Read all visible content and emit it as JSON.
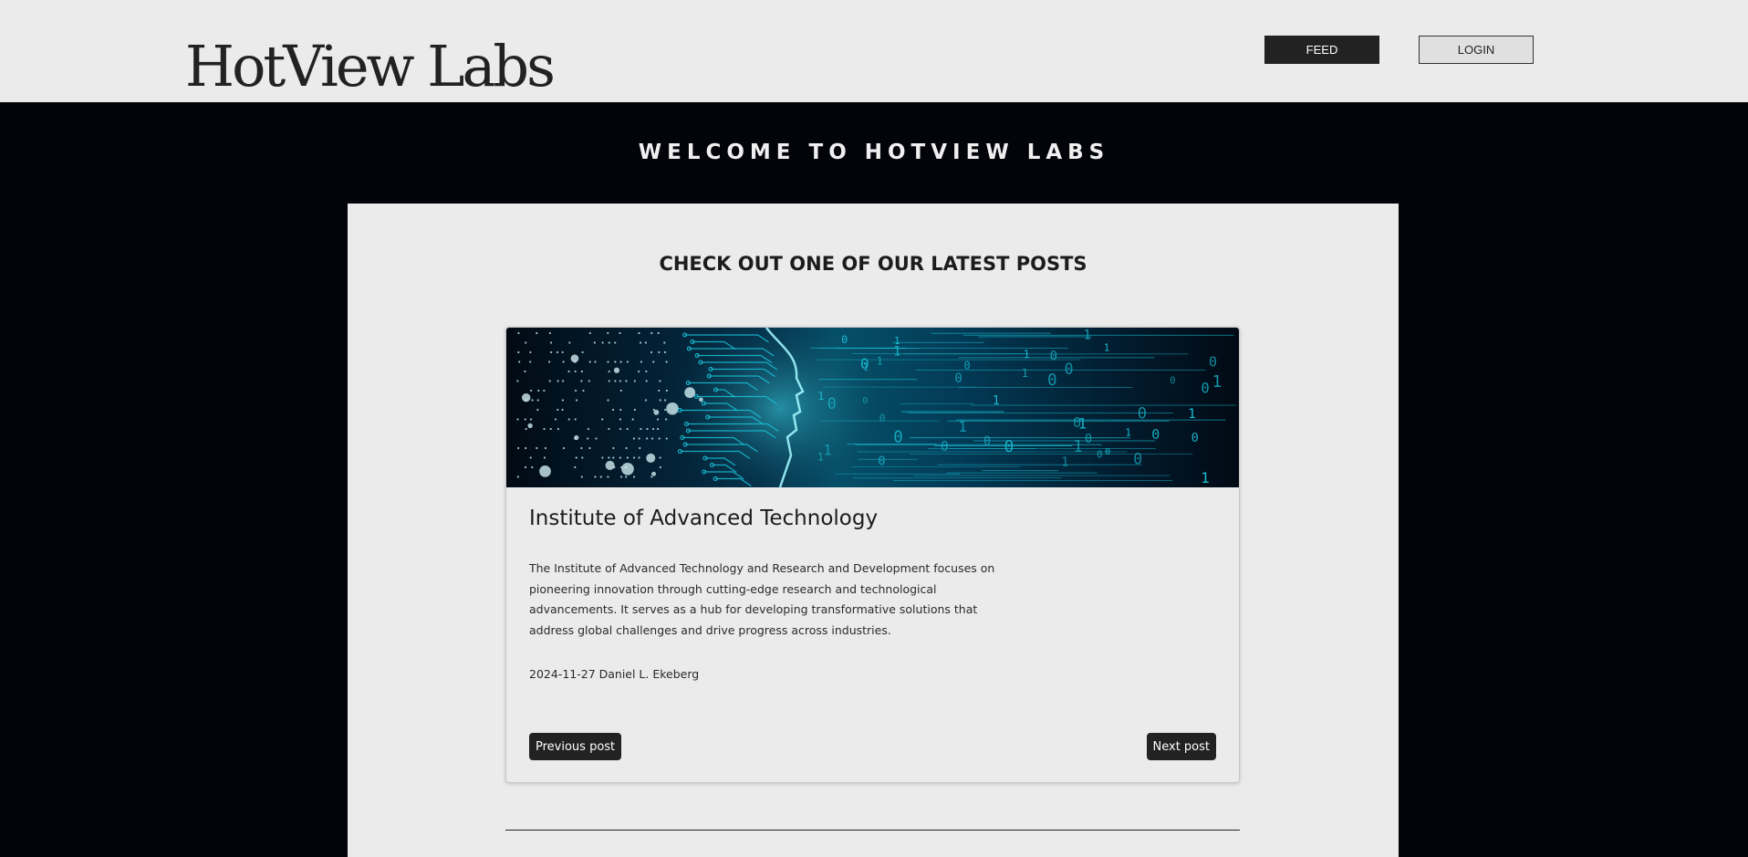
{
  "header": {
    "logo": "HotView Labs",
    "nav": {
      "feed_label": "FEED",
      "login_label": "LOGIN"
    }
  },
  "hero": {
    "title": "WELCOME TO HOTVIEW LABS"
  },
  "latest": {
    "title": "CHECK OUT ONE OF OUR LATEST POSTS",
    "post": {
      "title": "Institute of Advanced Technology",
      "body": "The Institute of Advanced Technology and Research and Development focuses on pioneering innovation through cutting-edge research and technological advancements. It serves as a hub for developing transformative solutions that address global challenges and drive progress across industries.",
      "meta": "2024-11-27 Daniel L. Ekeberg",
      "image": "ai-circuit-head-banner",
      "prev_label": "Previous post",
      "next_label": "Next post"
    }
  },
  "colors": {
    "topbar_bg": "#ebebeb",
    "page_bg": "#03040a",
    "panel_bg": "#ebebeb",
    "button_dark": "#222222",
    "banner_accent": "#19c2d6"
  }
}
